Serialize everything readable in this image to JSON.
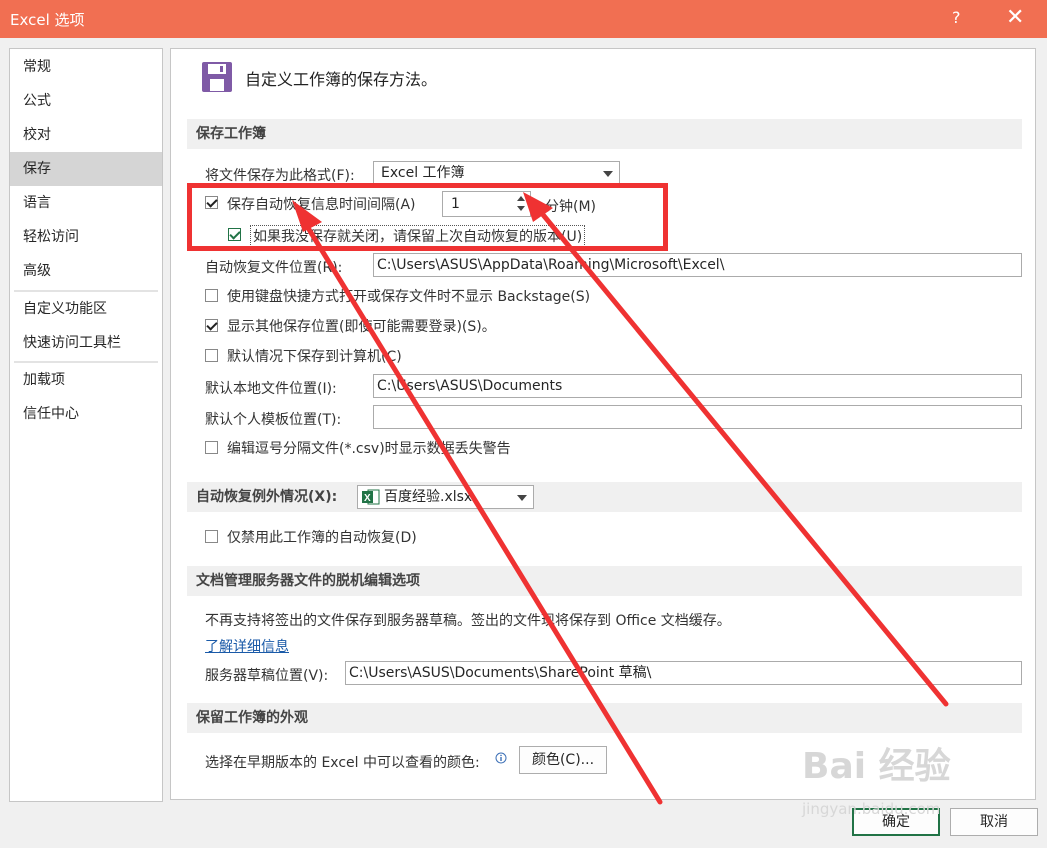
{
  "window": {
    "title": "Excel 选项",
    "help": "?",
    "close": "✕"
  },
  "sidebar": {
    "items": [
      "常规",
      "公式",
      "校对",
      "保存",
      "语言",
      "轻松访问",
      "高级",
      "自定义功能区",
      "快速访问工具栏",
      "加载项",
      "信任中心"
    ],
    "active": "保存"
  },
  "header": {
    "title": "自定义工作簿的保存方法。",
    "icon": "save-floppy-icon"
  },
  "save_workbooks": {
    "section_title": "保存工作簿",
    "format_label": "将文件保存为此格式(F):",
    "format_value": "Excel 工作簿",
    "autorecover_label": "保存自动恢复信息时间间隔(A)",
    "autorecover_checked": true,
    "autorecover_minutes": "1",
    "minutes_label": "分钟(M)",
    "keep_last_label": "如果我没保存就关闭，请保留上次自动恢复的版本(U)",
    "keep_last_checked": true,
    "autorecover_location_label": "自动恢复文件位置(R):",
    "autorecover_location_value": "C:\\Users\\ASUS\\AppData\\Roaming\\Microsoft\\Excel\\",
    "no_backstage_label": "使用键盘快捷方式打开或保存文件时不显示 Backstage(S)",
    "no_backstage_checked": false,
    "show_other_locations_label": "显示其他保存位置(即使可能需要登录)(S)。",
    "show_other_locations_checked": true,
    "save_to_computer_label": "默认情况下保存到计算机(C)",
    "save_to_computer_checked": false,
    "default_local_label": "默认本地文件位置(I):",
    "default_local_value": "C:\\Users\\ASUS\\Documents",
    "default_template_label": "默认个人模板位置(T):",
    "default_template_value": "",
    "csv_warning_label": "编辑逗号分隔文件(*.csv)时显示数据丢失警告",
    "csv_warning_checked": false
  },
  "autorecover_exceptions": {
    "section_title": "自动恢复例外情况(X):",
    "workbook": "百度经验.xlsx",
    "disable_label": "仅禁用此工作簿的自动恢复(D)",
    "disable_checked": false
  },
  "offline_editing": {
    "section_title": "文档管理服务器文件的脱机编辑选项",
    "notice": "不再支持将签出的文件保存到服务器草稿。签出的文件现将保存到 Office 文档缓存。",
    "learn_more": "了解详细信息",
    "drafts_label": "服务器草稿位置(V):",
    "drafts_value": "C:\\Users\\ASUS\\Documents\\SharePoint 草稿\\"
  },
  "appearance": {
    "section_title": "保留工作簿的外观",
    "colors_label": "选择在早期版本的 Excel 中可以查看的颜色:",
    "colors_button": "颜色(C)..."
  },
  "footer": {
    "ok": "确定",
    "cancel": "取消"
  },
  "watermark": {
    "brand": "Bai 经验",
    "url": "jingyan.baidu.com"
  },
  "colors": {
    "title_bar": "#f16f52",
    "annotation": "#ef3232",
    "excel_green": "#217346"
  }
}
